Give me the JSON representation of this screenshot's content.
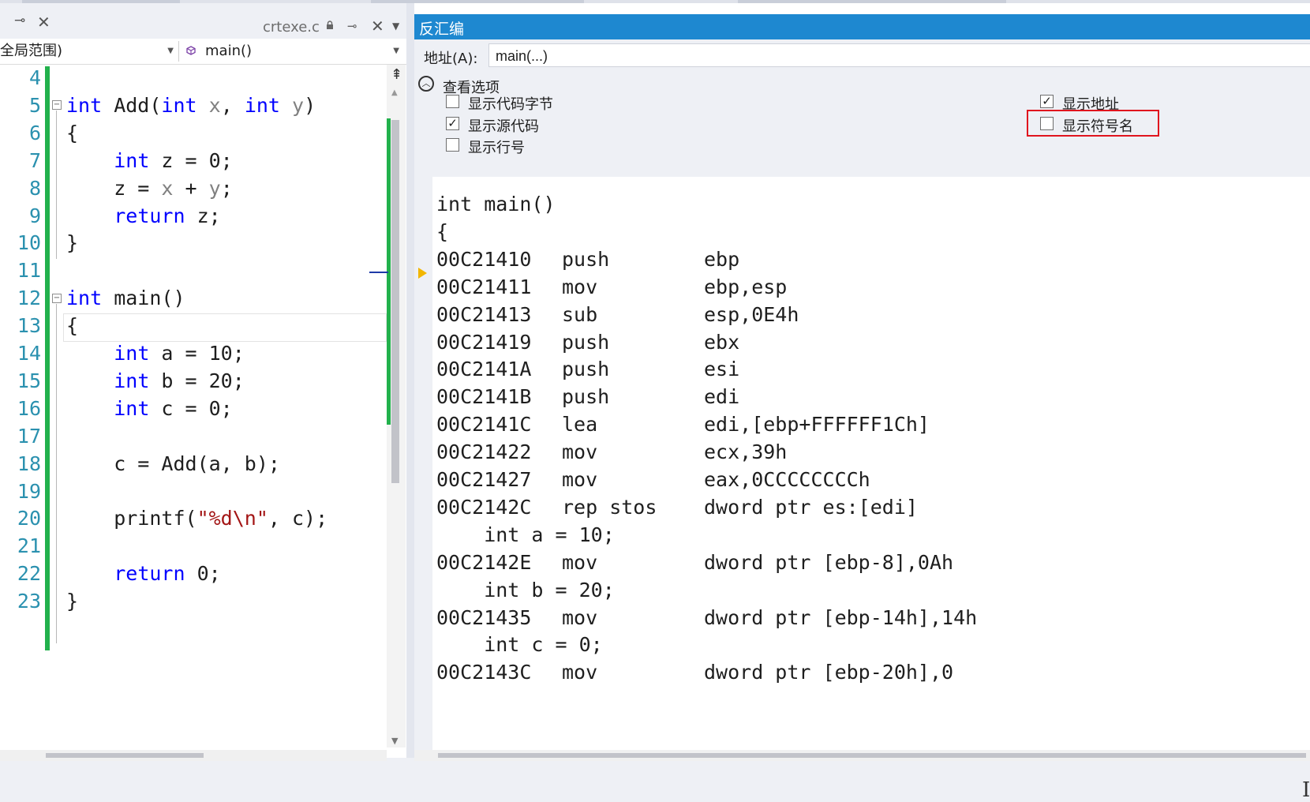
{
  "editor": {
    "tab_filename": "crtexe.c",
    "scope_select": "全局范围)",
    "function_select": "main()",
    "line_numbers": [
      "4",
      "5",
      "6",
      "7",
      "8",
      "9",
      "10",
      "11",
      "12",
      "13",
      "14",
      "15",
      "16",
      "17",
      "18",
      "19",
      "20",
      "21",
      "22",
      "23"
    ],
    "code_lines": [
      [],
      [
        {
          "t": "int",
          "c": "kw"
        },
        {
          "t": " Add("
        },
        {
          "t": "int",
          "c": "kw"
        },
        {
          "t": " "
        },
        {
          "t": "x",
          "c": "pm"
        },
        {
          "t": ", "
        },
        {
          "t": "int",
          "c": "kw"
        },
        {
          "t": " "
        },
        {
          "t": "y",
          "c": "pm"
        },
        {
          "t": ")"
        }
      ],
      [
        {
          "t": "{"
        }
      ],
      [
        {
          "t": "    "
        },
        {
          "t": "int",
          "c": "kw"
        },
        {
          "t": " z = 0;"
        }
      ],
      [
        {
          "t": "    z = "
        },
        {
          "t": "x",
          "c": "pm"
        },
        {
          "t": " + "
        },
        {
          "t": "y",
          "c": "pm"
        },
        {
          "t": ";"
        }
      ],
      [
        {
          "t": "    "
        },
        {
          "t": "return",
          "c": "kw"
        },
        {
          "t": " z;"
        }
      ],
      [
        {
          "t": "}"
        }
      ],
      [],
      [
        {
          "t": "int",
          "c": "kw"
        },
        {
          "t": " main()"
        }
      ],
      [
        {
          "t": "{"
        }
      ],
      [
        {
          "t": "    "
        },
        {
          "t": "int",
          "c": "kw"
        },
        {
          "t": " a = 10;"
        }
      ],
      [
        {
          "t": "    "
        },
        {
          "t": "int",
          "c": "kw"
        },
        {
          "t": " b = 20;"
        }
      ],
      [
        {
          "t": "    "
        },
        {
          "t": "int",
          "c": "kw"
        },
        {
          "t": " c = 0;"
        }
      ],
      [],
      [
        {
          "t": "    c = Add(a, b);"
        }
      ],
      [],
      [
        {
          "t": "    printf("
        },
        {
          "t": "\"%d\\n\"",
          "c": "str"
        },
        {
          "t": ", c);"
        }
      ],
      [],
      [
        {
          "t": "    "
        },
        {
          "t": "return",
          "c": "kw"
        },
        {
          "t": " 0;"
        }
      ],
      [
        {
          "t": "}"
        }
      ]
    ]
  },
  "disassembly": {
    "title": "反汇编",
    "address_label": "地址(A):",
    "address_value": "main(...)",
    "view_options_label": "查看选项",
    "options": [
      {
        "label": "显示代码字节",
        "checked": false
      },
      {
        "label": "显示源代码",
        "checked": true
      },
      {
        "label": "显示行号",
        "checked": false
      },
      {
        "label": "显示地址",
        "checked": true
      },
      {
        "label": "显示符号名",
        "checked": false
      }
    ],
    "lines": [
      {
        "type": "src",
        "text": "int main()"
      },
      {
        "type": "src",
        "text": "{"
      },
      {
        "type": "asm",
        "addr": "00C21410",
        "mn": "push",
        "op": "ebp"
      },
      {
        "type": "asm",
        "addr": "00C21411",
        "mn": "mov",
        "op": "ebp,esp"
      },
      {
        "type": "asm",
        "addr": "00C21413",
        "mn": "sub",
        "op": "esp,0E4h"
      },
      {
        "type": "asm",
        "addr": "00C21419",
        "mn": "push",
        "op": "ebx"
      },
      {
        "type": "asm",
        "addr": "00C2141A",
        "mn": "push",
        "op": "esi"
      },
      {
        "type": "asm",
        "addr": "00C2141B",
        "mn": "push",
        "op": "edi"
      },
      {
        "type": "asm",
        "addr": "00C2141C",
        "mn": "lea",
        "op": "edi,[ebp+FFFFFF1Ch]"
      },
      {
        "type": "asm",
        "addr": "00C21422",
        "mn": "mov",
        "op": "ecx,39h"
      },
      {
        "type": "asm",
        "addr": "00C21427",
        "mn": "mov",
        "op": "eax,0CCCCCCCCh"
      },
      {
        "type": "asm",
        "addr": "00C2142C",
        "mn": "rep stos",
        "op": "dword ptr es:[edi]"
      },
      {
        "type": "src",
        "text": "    int a = 10;"
      },
      {
        "type": "asm",
        "addr": "00C2142E",
        "mn": "mov",
        "op": "dword ptr [ebp-8],0Ah"
      },
      {
        "type": "src",
        "text": "    int b = 20;"
      },
      {
        "type": "asm",
        "addr": "00C21435",
        "mn": "mov",
        "op": "dword ptr [ebp-14h],14h"
      },
      {
        "type": "src",
        "text": "    int c = 0;"
      },
      {
        "type": "asm",
        "addr": "00C2143C",
        "mn": "mov",
        "op": "dword ptr [ebp-20h],0"
      }
    ]
  },
  "colors": {
    "keyword": "#0000ff",
    "parameter": "#808080",
    "string": "#a31515",
    "line_number": "#2b91af",
    "change_bar": "#22b14c",
    "title_bar": "#1e88d0",
    "highlight": "#e0141e"
  },
  "icons": {
    "pin": "pin-icon",
    "close": "close-icon",
    "lock": "lock-icon",
    "function": "cube-icon",
    "ip": "instruction-pointer-arrow-icon"
  }
}
